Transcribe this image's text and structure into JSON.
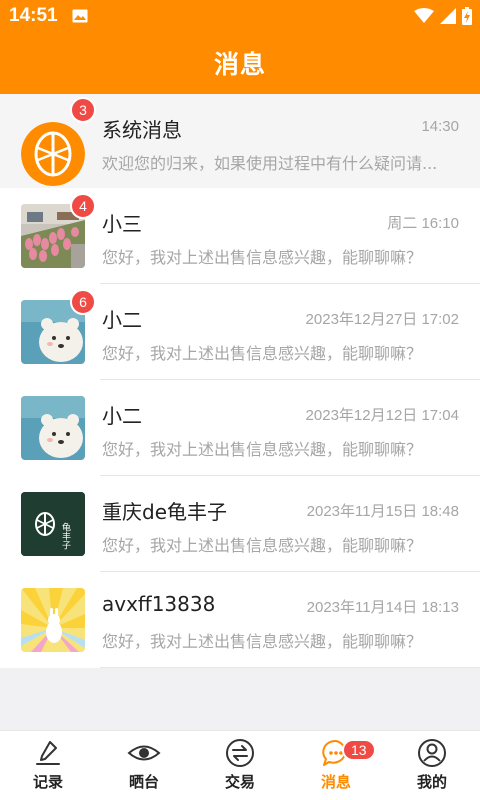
{
  "status_bar": {
    "time": "14:51"
  },
  "header": {
    "title": "消息"
  },
  "conversations": [
    {
      "name": "系统消息",
      "time": "14:30",
      "preview": "欢迎您的归来，如果使用过程中有什么疑问请...",
      "badge": "3",
      "avatar": "brand-logo-orange"
    },
    {
      "name": "小三",
      "time": "周二 16:10",
      "preview": "您好，我对上述出售信息感兴趣，能聊聊嘛？",
      "badge": "4",
      "avatar": "tulip-photo"
    },
    {
      "name": "小二",
      "time": "2023年12月27日 17:02",
      "preview": "您好，我对上述出售信息感兴趣，能聊聊嘛？",
      "badge": "6",
      "avatar": "bear-illustration"
    },
    {
      "name": "小二",
      "time": "2023年12月12日 17:04",
      "preview": "您好，我对上述出售信息感兴趣，能聊聊嘛？",
      "badge": "",
      "avatar": "bear-illustration"
    },
    {
      "name": "重庆de龟丰子",
      "time": "2023年11月15日 18:48",
      "preview": "您好，我对上述出售信息感兴趣，能聊聊嘛？",
      "badge": "",
      "avatar": "brand-logo-green",
      "avatar_text": "龟丰子"
    },
    {
      "name": "avxff13838",
      "time": "2023年11月14日 18:13",
      "preview": "您好，我对上述出售信息感兴趣，能聊聊嘛？",
      "badge": "",
      "avatar": "sunburst-illustration"
    }
  ],
  "tabbar": {
    "items": [
      {
        "label": "记录",
        "icon": "pen-icon"
      },
      {
        "label": "晒台",
        "icon": "eye-icon"
      },
      {
        "label": "交易",
        "icon": "exchange-icon"
      },
      {
        "label": "消息",
        "icon": "chat-icon",
        "badge": "13",
        "active": true
      },
      {
        "label": "我的",
        "icon": "profile-icon"
      }
    ]
  },
  "colors": {
    "brand": "#ff8c00",
    "badge": "#f04a45",
    "brand_green": "#1f3d30"
  }
}
